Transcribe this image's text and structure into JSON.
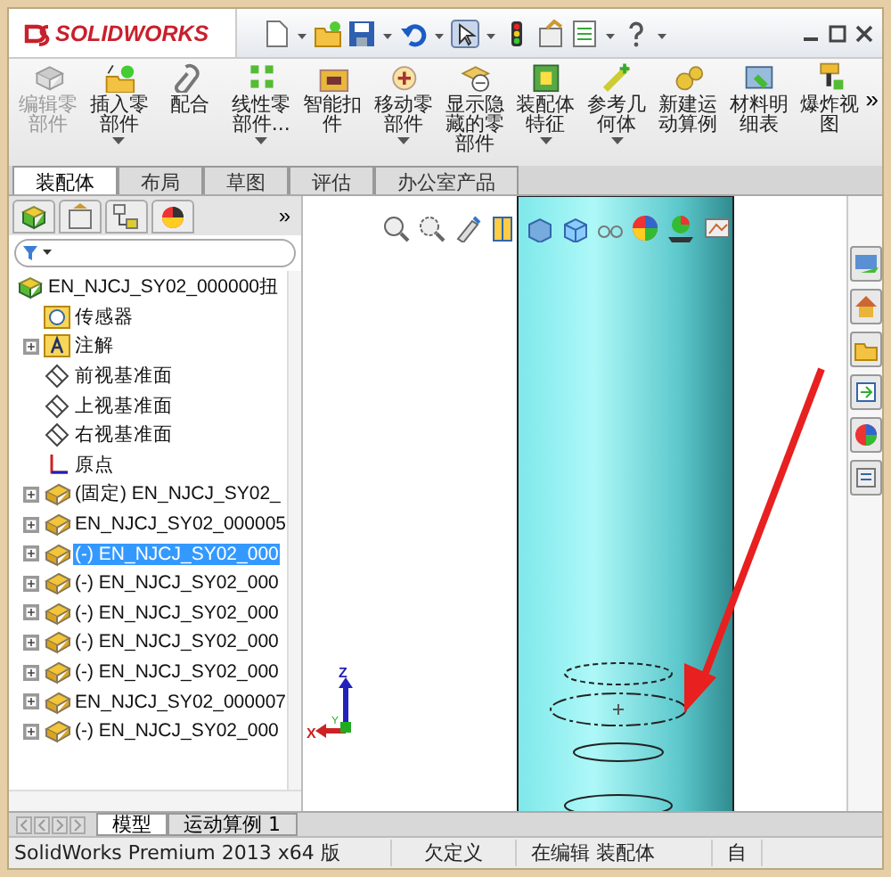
{
  "app": {
    "logo": "SOLIDWORKS"
  },
  "ribbon": {
    "buttons": [
      {
        "label": "编辑零部件",
        "disabled": true,
        "dropdown": false
      },
      {
        "label": "插入零部件",
        "disabled": false,
        "dropdown": true
      },
      {
        "label": "配合",
        "disabled": false,
        "dropdown": false
      },
      {
        "label": "线性零部件...",
        "disabled": false,
        "dropdown": true
      },
      {
        "label": "智能扣件",
        "disabled": false,
        "dropdown": false
      },
      {
        "label": "移动零部件",
        "disabled": false,
        "dropdown": true
      },
      {
        "label": "显示隐藏的零部件",
        "disabled": false,
        "dropdown": false
      },
      {
        "label": "装配体特征",
        "disabled": false,
        "dropdown": true
      },
      {
        "label": "参考几何体",
        "disabled": false,
        "dropdown": true
      },
      {
        "label": "新建运动算例",
        "disabled": false,
        "dropdown": false
      },
      {
        "label": "材料明细表",
        "disabled": false,
        "dropdown": false
      },
      {
        "label": "爆炸视图",
        "disabled": false,
        "dropdown": false
      }
    ],
    "more": "»"
  },
  "tabs": [
    {
      "label": "装配体",
      "selected": true
    },
    {
      "label": "布局",
      "selected": false
    },
    {
      "label": "草图",
      "selected": false
    },
    {
      "label": "评估",
      "selected": false
    },
    {
      "label": "办公室产品",
      "selected": false
    }
  ],
  "panel": {
    "more": "»",
    "tree": [
      {
        "label": "EN_NJCJ_SY02_000000扭",
        "kind": "assembly",
        "expandable": false,
        "selected": false,
        "children": [
          {
            "label": "传感器",
            "kind": "sensor",
            "expandable": false,
            "selected": false
          },
          {
            "label": "注解",
            "kind": "annotation",
            "expandable": true,
            "selected": false
          },
          {
            "label": "前视基准面",
            "kind": "plane",
            "expandable": false,
            "selected": false
          },
          {
            "label": "上视基准面",
            "kind": "plane",
            "expandable": false,
            "selected": false
          },
          {
            "label": "右视基准面",
            "kind": "plane",
            "expandable": false,
            "selected": false
          },
          {
            "label": "原点",
            "kind": "origin",
            "expandable": false,
            "selected": false
          },
          {
            "label": "(固定) EN_NJCJ_SY02_",
            "kind": "part",
            "expandable": true,
            "selected": false
          },
          {
            "label": "EN_NJCJ_SY02_000005",
            "kind": "part",
            "expandable": true,
            "selected": false
          },
          {
            "label": "(-) EN_NJCJ_SY02_000",
            "kind": "part",
            "expandable": true,
            "selected": true
          },
          {
            "label": "(-) EN_NJCJ_SY02_000",
            "kind": "part",
            "expandable": true,
            "selected": false
          },
          {
            "label": "(-) EN_NJCJ_SY02_000",
            "kind": "part",
            "expandable": true,
            "selected": false
          },
          {
            "label": "(-) EN_NJCJ_SY02_000",
            "kind": "part",
            "expandable": true,
            "selected": false
          },
          {
            "label": "(-) EN_NJCJ_SY02_000",
            "kind": "part",
            "expandable": true,
            "selected": false
          },
          {
            "label": "EN_NJCJ_SY02_000007",
            "kind": "part",
            "expandable": true,
            "selected": false
          },
          {
            "label": "(-) EN_NJCJ_SY02_000",
            "kind": "part",
            "expandable": true,
            "selected": false
          }
        ]
      }
    ]
  },
  "triad": {
    "z": "Z",
    "x": "X",
    "y": "Y"
  },
  "bottom_tabs": [
    {
      "label": "模型",
      "selected": true
    },
    {
      "label": "运动算例 1",
      "selected": false
    }
  ],
  "status_bar": [
    "SolidWorks Premium 2013 x64 版",
    "欠定义",
    "在编辑 装配体",
    "自"
  ]
}
